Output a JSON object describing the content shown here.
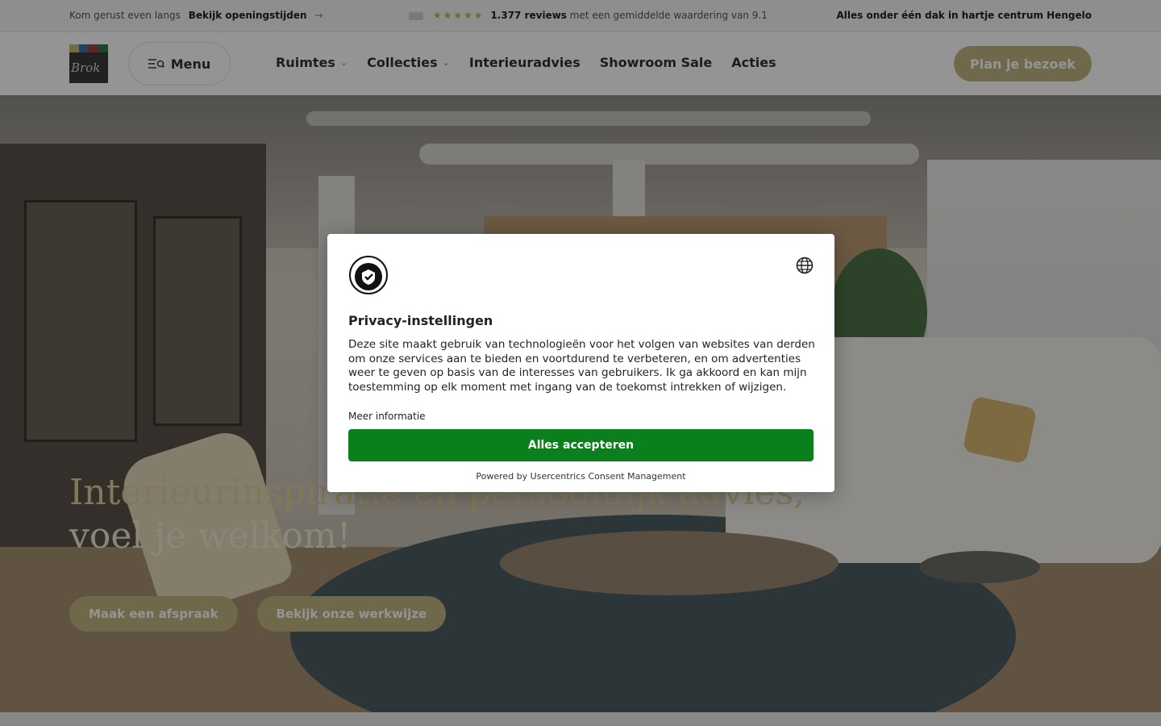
{
  "topbar": {
    "visit_text": "Kom gerust even langs",
    "hours_link": "Bekijk openingstijden",
    "arrow": "→",
    "stars": "★★★★★",
    "reviews_count": "1.377 reviews",
    "reviews_text": "met een gemiddelde waardering van 9.1",
    "tagline": "Alles onder één dak in hartje centrum Hengelo"
  },
  "header": {
    "logo_text": "Brok",
    "logo_colors": [
      "#c9b870",
      "#3b6fa8",
      "#a83b3b",
      "#2f7a4a"
    ],
    "menu_label": "Menu",
    "nav": [
      {
        "label": "Ruimtes",
        "has_dropdown": true
      },
      {
        "label": "Collecties",
        "has_dropdown": true
      },
      {
        "label": "Interieuradvies",
        "has_dropdown": false
      },
      {
        "label": "Showroom Sale",
        "has_dropdown": false
      },
      {
        "label": "Acties",
        "has_dropdown": false
      }
    ],
    "cta": "Plan je bezoek"
  },
  "hero": {
    "title_line1": "Interieurinspiratie en persoonlijk advies,",
    "title_line2": "voel je welkom!",
    "buttons": [
      "Maak een afspraak",
      "Bekijk onze werkwijze"
    ]
  },
  "consent": {
    "title": "Privacy-instellingen",
    "body": "Deze site maakt gebruik van technologieën voor het volgen van websites van derden om onze services aan te bieden en voortdurend te verbeteren, en om advertenties weer te geven op basis van de interesses van gebruikers. Ik ga akkoord en kan mijn toestemming op elk moment met ingang van de toekomst intrekken of wijzigen.",
    "more_info": "Meer informatie",
    "accept": "Alles accepteren",
    "powered_by": "Powered by Usercentrics Consent Management"
  },
  "colors": {
    "accent": "#c2b382",
    "accept_green": "#0a7f1b"
  }
}
